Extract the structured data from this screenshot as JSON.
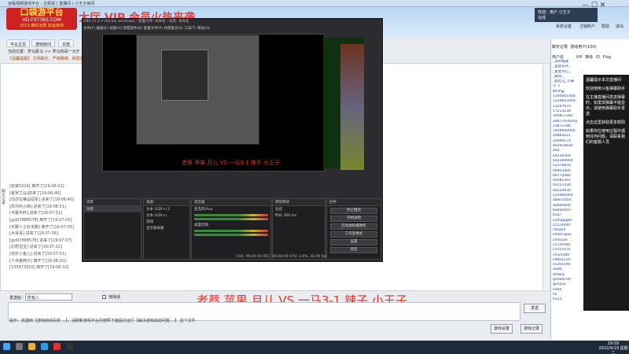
{
  "window": {
    "title": "远程视频连线平台 - 主频道 ( 直播间 ) 小王子房间"
  },
  "banner": {
    "logo_line1": "口袋游平台",
    "logo_line2": "HD.FXT365.COM",
    "logo_line3": "2013 精彩无限 好运有你",
    "promo": "大厅 VIP 会员火热来袭"
  },
  "nav": {
    "buttons": [
      "平台主页",
      "游戏房间",
      "充值"
    ]
  },
  "window_controls": "— ☐ ✕",
  "user_panel": {
    "line1": "欢迎：用户 小王子",
    "line2": "在线"
  },
  "system_buttons": [
    "系统设置",
    "注销账户",
    "帮助",
    "退出"
  ],
  "location": "当前位置：罗马蒙马 >> 罗马热闹一大厅",
  "notice": "【温馨提醒】 文明聊天，严禁赌博，刷屏发广告者封号处理",
  "edge_label": "聊天记录",
  "events": [
    "[玩家0314] 离开了[19:06:02]",
    "[紫罗兰@]进来了[19:06:40]",
    "[玛莎拉蒂@冠军] 进来了[19:06:40]",
    "[风中的小雨] 进来了[19:06:51]",
    "[半醒半醉] 进来了[19:07:01]",
    "[gzj97888578] 离开了[19:07:05]",
    "[无聊人士好无聊] 离开了[19:07:05]",
    "[大哥哥] 进来了[19:07:06]",
    "[gzj97888578] 进来了[19:07:07]",
    "[幻想宝宝] 进来了[19:07:22]",
    "[快乐小鱼儿] 进来了[19:07:51]",
    "[十点差两分] 离开了[19:08:30]",
    "[135973310] 离开了[19:08:32]"
  ],
  "message": "老蔡  苹果  月儿  VS  一马3-1  辣子  小王子",
  "send": {
    "label": "发送给：",
    "target": "所有人",
    "checkbox_label": "悄悄话",
    "send_button": "发送"
  },
  "tip": "提示：如遇到【游戏启动失败 ...】，请刷新游戏平台并按照下面提示运行【解决游戏启动问题 ...】 这个文件",
  "bottom_buttons": [
    "游戏设置",
    "游戏记录"
  ],
  "right_panel": {
    "tabs": [
      "聊天记录",
      "游戏用户(100)"
    ],
    "columns": [
      "用户名",
      "VIP",
      "等级",
      "ID",
      "Flag"
    ],
    "users": [
      "_萍水相逢",
      "_蓝莲花开_",
      "_星星点灯_",
      "_微凉_",
      "_醉红尘_小满",
      "小飞",
      "KK宇宙",
      "1300001000",
      "1330605000",
      "13207670",
      "17213230",
      "160817282",
      "28477030292",
      "23872780",
      "1409000000",
      "26864221",
      "20009174",
      "402020830",
      "402",
      "44230500",
      "502300004",
      "52378450",
      "00903405",
      "00770480",
      "00085361",
      "00251030",
      "00224930",
      "a1x4B0004",
      "abw11050",
      "a0b00600",
      "badlan007",
      "b1p7",
      "cumigopkh",
      "cc113400",
      "cd5zE4",
      "cheer1pos",
      "chnuyas",
      "cn150180",
      "cn257076",
      "cm20300",
      "cd001210",
      "cn201590",
      "d2B0",
      "dreeky",
      "g1000700",
      "gunyu1",
      "hoda",
      "hx",
      "hu13"
    ]
  },
  "ad": {
    "line1": "温馨提示本次直播间",
    "line2": "欢迎使用斗鱼弹幕助手",
    "line3": "在主播直播间发送弹幕时，如发现弹幕不能显示，请使用弹幕助手发送",
    "line4": "点击这里获取更多帮助",
    "line5": "如果你在使用过程中遇到任何问题，请联系我们的客服人员"
  },
  "taskbar": {
    "time": "19:59",
    "date": "2022/4/19 星期二"
  },
  "obs": {
    "title": "OBS 27.2.4 (64-bit, windows) - 配置文件: 未命名 - 场景: 未命名",
    "menu": "文件(F)   编辑(E)   视图(V)   停靠部件(D)   配置文件(P)   场景集合(S)   工具(T)   帮助(H)",
    "overlay_text": "老蔡 苹果 月儿 VS 一马3-1 辣子 小王子",
    "scenes_header": "场景",
    "scene_name": "场景",
    "sources_header": "来源",
    "sources": [
      "文本 (GDI+) 2",
      "文本 (GDI+)",
      "游戏",
      "显示器采集"
    ],
    "mixer_header": "混音器",
    "mixer_tracks": [
      "麦克风/Aux",
      "桌面音频"
    ],
    "transitions_header": "转场特效",
    "transition": "淡出",
    "duration_label": "时长",
    "duration": "300 ms",
    "controls_header": "控件",
    "controls": [
      "停止推流",
      "开始录制",
      "启动虚拟摄像机",
      "工作室模式",
      "设置",
      "退出"
    ],
    "status": "LIVE: 00:00:00   REC: 00:00:00   CPU: 3.0%, 30.00 fps"
  }
}
